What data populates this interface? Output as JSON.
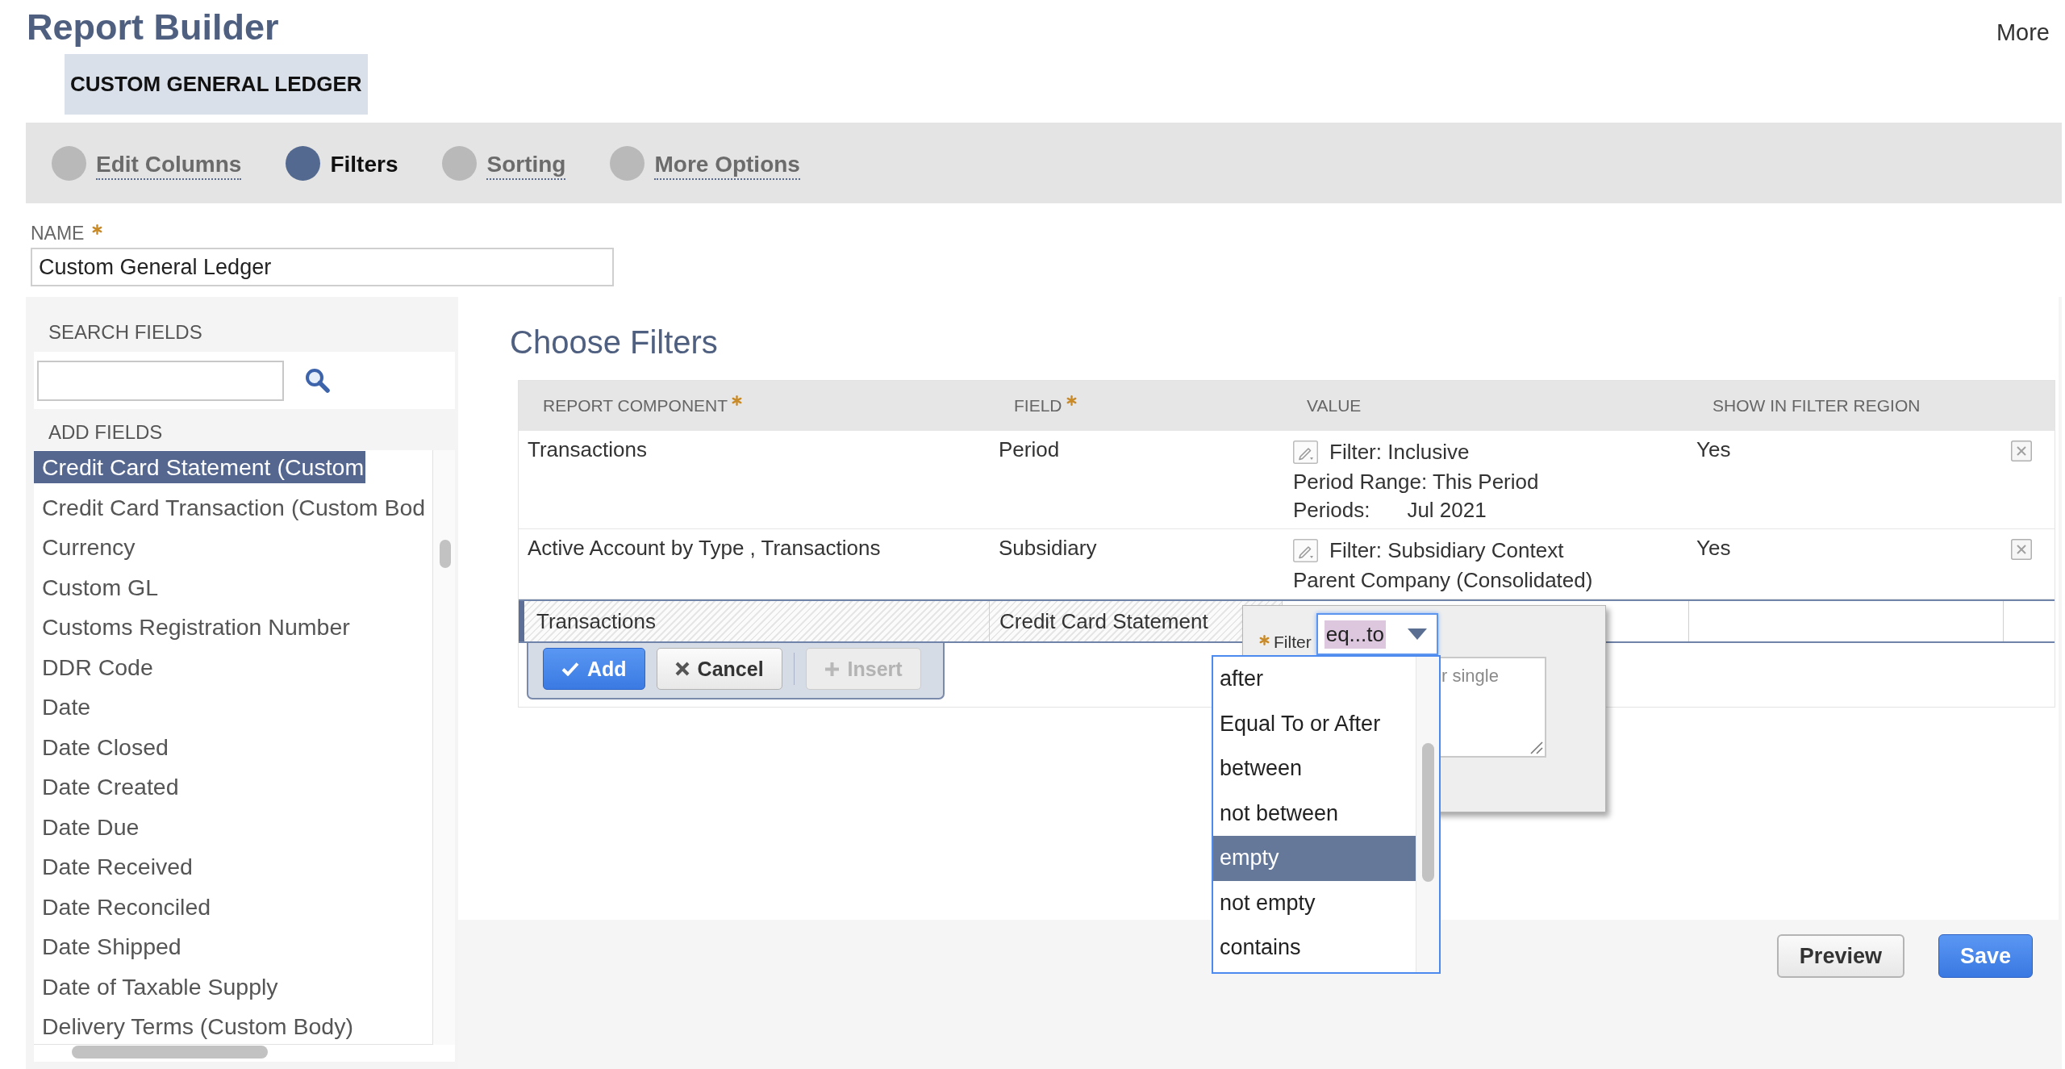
{
  "header": {
    "title": "Report Builder",
    "more_link": "More",
    "record_name": "CUSTOM GENERAL LEDGER"
  },
  "steps": [
    {
      "label": "Edit Columns",
      "selected": false
    },
    {
      "label": "Filters",
      "selected": true
    },
    {
      "label": "Sorting",
      "selected": false
    },
    {
      "label": "More Options",
      "selected": false
    }
  ],
  "name_field": {
    "label": "NAME",
    "required": true,
    "value": "Custom General Ledger"
  },
  "field_panel": {
    "search_label": "SEARCH FIELDS",
    "add_label": "ADD FIELDS",
    "items": [
      {
        "label": "Credit Card Statement (Custom",
        "selected": true
      },
      {
        "label": "Credit Card Transaction (Custom Bod",
        "selected": false
      },
      {
        "label": "Currency",
        "selected": false
      },
      {
        "label": "Custom GL",
        "selected": false
      },
      {
        "label": "Customs Registration Number",
        "selected": false
      },
      {
        "label": "DDR Code",
        "selected": false
      },
      {
        "label": "Date",
        "selected": false
      },
      {
        "label": "Date Closed",
        "selected": false
      },
      {
        "label": "Date Created",
        "selected": false
      },
      {
        "label": "Date Due",
        "selected": false
      },
      {
        "label": "Date Received",
        "selected": false
      },
      {
        "label": "Date Reconciled",
        "selected": false
      },
      {
        "label": "Date Shipped",
        "selected": false
      },
      {
        "label": "Date of Taxable Supply",
        "selected": false
      },
      {
        "label": "Delivery Terms (Custom Body)",
        "selected": false
      }
    ]
  },
  "filters": {
    "title": "Choose Filters",
    "columns": [
      {
        "label": "REPORT COMPONENT",
        "required": true
      },
      {
        "label": "FIELD",
        "required": true
      },
      {
        "label": "VALUE",
        "required": false
      },
      {
        "label": "SHOW IN FILTER REGION",
        "required": false
      }
    ],
    "rows": [
      {
        "component": "Transactions",
        "field": "Period",
        "value_lines": [
          {
            "parts": [
              "Filter: Inclusive"
            ]
          },
          {
            "parts": [
              "Period Range: This Period"
            ]
          },
          {
            "parts": [
              "Periods:",
              "Jul 2021"
            ]
          }
        ],
        "show_in_filter_region": "Yes"
      },
      {
        "component": "Active Account by Type , Transactions",
        "field": "Subsidiary",
        "value_lines": [
          {
            "parts": [
              "Filter: Subsidiary Context"
            ]
          },
          {
            "parts": [
              "Parent Company (Consolidated)"
            ]
          }
        ],
        "show_in_filter_region": "Yes"
      }
    ],
    "edit_row": {
      "component": "Transactions",
      "field": "Credit Card Statement"
    },
    "edit_buttons": [
      {
        "label": "Add",
        "kind": "confirm",
        "disabled": false
      },
      {
        "label": "Cancel",
        "kind": "cancel",
        "disabled": false
      },
      {
        "label": "Insert",
        "kind": "insert",
        "disabled": true
      }
    ]
  },
  "filter_popup": {
    "label": "Filter",
    "required": true,
    "select_value": "eq...to",
    "textarea": {
      "placeholder": "r single"
    },
    "options": [
      {
        "label": "after",
        "selected": false
      },
      {
        "label": "Equal To or After",
        "selected": false
      },
      {
        "label": "between",
        "selected": false
      },
      {
        "label": "not between",
        "selected": false
      },
      {
        "label": "empty",
        "selected": true
      },
      {
        "label": "not empty",
        "selected": false
      },
      {
        "label": "contains",
        "selected": false
      }
    ]
  },
  "footer_buttons": [
    {
      "label": "Preview",
      "kind": "secondary"
    },
    {
      "label": "Save",
      "kind": "primary"
    }
  ]
}
